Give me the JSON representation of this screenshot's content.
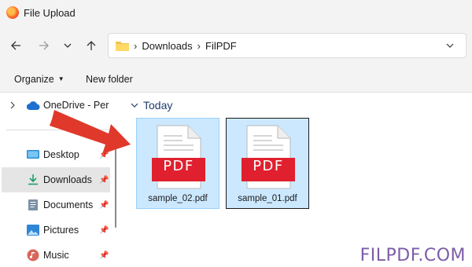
{
  "window": {
    "title": "File Upload"
  },
  "nav": {
    "back_icon": "arrow-left-icon",
    "forward_icon": "arrow-right-icon",
    "recent_icon": "chevron-down-icon",
    "up_icon": "arrow-up-icon"
  },
  "address": {
    "separator": "›",
    "crumbs": [
      "Downloads",
      "FilPDF"
    ]
  },
  "commands": {
    "organize": "Organize",
    "new_folder": "New folder"
  },
  "sidebar": {
    "items": [
      {
        "label": "OneDrive - Personal",
        "icon": "cloud-icon"
      },
      {
        "label": "Desktop",
        "icon": "desktop-icon",
        "pinned": true
      },
      {
        "label": "Downloads",
        "icon": "download-icon",
        "pinned": true,
        "active": true
      },
      {
        "label": "Documents",
        "icon": "document-icon",
        "pinned": true
      },
      {
        "label": "Pictures",
        "icon": "pictures-icon",
        "pinned": true
      },
      {
        "label": "Music",
        "icon": "music-icon",
        "pinned": true
      }
    ]
  },
  "main": {
    "group_label": "Today",
    "files": [
      {
        "name": "sample_02.pdf",
        "badge": "PDF"
      },
      {
        "name": "sample_01.pdf",
        "badge": "PDF"
      }
    ]
  },
  "watermark": "FILPDF.COM",
  "colors": {
    "selection": "#cce8ff",
    "pdf_red": "#e0202e",
    "arrow": "#e0392b",
    "watermark": "#7d5da8"
  }
}
